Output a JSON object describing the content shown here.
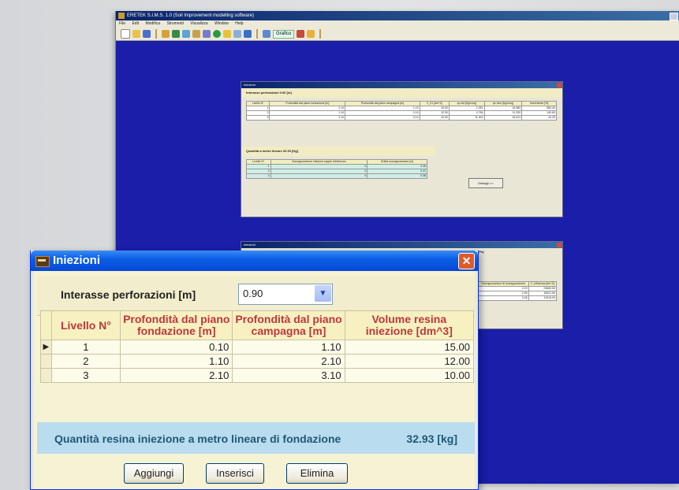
{
  "app": {
    "title": "ERETEK S.I.M.S. 1.0 (Soil Improvement modelling software)",
    "menu": [
      "File",
      "Edit",
      "Modifica",
      "Strumenti",
      "Visualizza",
      "Window",
      "Help"
    ],
    "toolbar_grafico": "Grafico",
    "colors": {
      "workspace": "#1a1ea8",
      "titlebar": "#0a246a"
    }
  },
  "mini1": {
    "title": "Iniezioni",
    "interasse": "Interasse perforazioni        0.90 [m]",
    "columns": [
      "Livello N°",
      "Profondità dal piano fondazione [m]",
      "Profondità dal piano campagna [m]",
      "V_01 [dm^3]",
      "qc old [Kg/cmq]",
      "qc new [Kg/cmq]",
      "Incremento [%]"
    ],
    "rows": [
      [
        "1",
        "0.10",
        "1.10",
        "15.00",
        "2.281",
        "15.560",
        "583.40"
      ],
      [
        "2",
        "1.10",
        "2.10",
        "12.00",
        "4.784",
        "11.320",
        "140.60"
      ],
      [
        "3",
        "2.10",
        "3.10",
        "10.00",
        "11.902",
        "16.613",
        "40.30"
      ]
    ],
    "quantita": "Quantità a metro lineare        32.93 [Kg]",
    "columns2": [
      "Livello N°",
      "Sovrapposizione iniezioni coppie d'influenza",
      "Entità sovrapposizione [m]"
    ],
    "rows2": [
      [
        "1",
        "0",
        "0.46"
      ],
      [
        "2",
        "0",
        "0.41"
      ],
      [
        "3",
        "0",
        "0.38"
      ]
    ],
    "dettagli": "Dettagli >>"
  },
  "mini2": {
    "title": "Iniezioni",
    "unit": "[Pa]",
    "columns": [
      "Sovrapposizione di sovrapposizione",
      "V_influenza [dm^3]"
    ],
    "rows": [
      [
        "2.20",
        "23650.50"
      ],
      [
        "2.59",
        "18421.50"
      ],
      [
        "3.26",
        "15115.00"
      ]
    ]
  },
  "dialog": {
    "title": "Iniezioni",
    "interasse_label": "Interasse perforazioni [m]",
    "interasse_value": "0.90",
    "columns": [
      "Livello N°",
      "Profondità dal piano fondazione [m]",
      "Profondità dal piano campagna [m]",
      "Volume resina iniezione  [dm^3]"
    ],
    "rows": [
      {
        "livello": "1",
        "fondazione": "0.10",
        "campagna": "1.10",
        "volume": "15.00"
      },
      {
        "livello": "2",
        "fondazione": "1.10",
        "campagna": "2.10",
        "volume": "12.00"
      },
      {
        "livello": "3",
        "fondazione": "2.10",
        "campagna": "3.10",
        "volume": "10.00"
      }
    ],
    "row_indicator": "▶",
    "quantita_label": "Quantità resina iniezione a metro lineare di fondazione",
    "quantita_value": "32.93 [kg]",
    "buttons": {
      "aggiungi": "Aggiungi",
      "inserisci": "Inserisci",
      "elimina": "Elimina"
    },
    "colors": {
      "header_text": "#c0373a",
      "info_bar": "#b9dcee",
      "info_text": "#1f5977"
    }
  }
}
